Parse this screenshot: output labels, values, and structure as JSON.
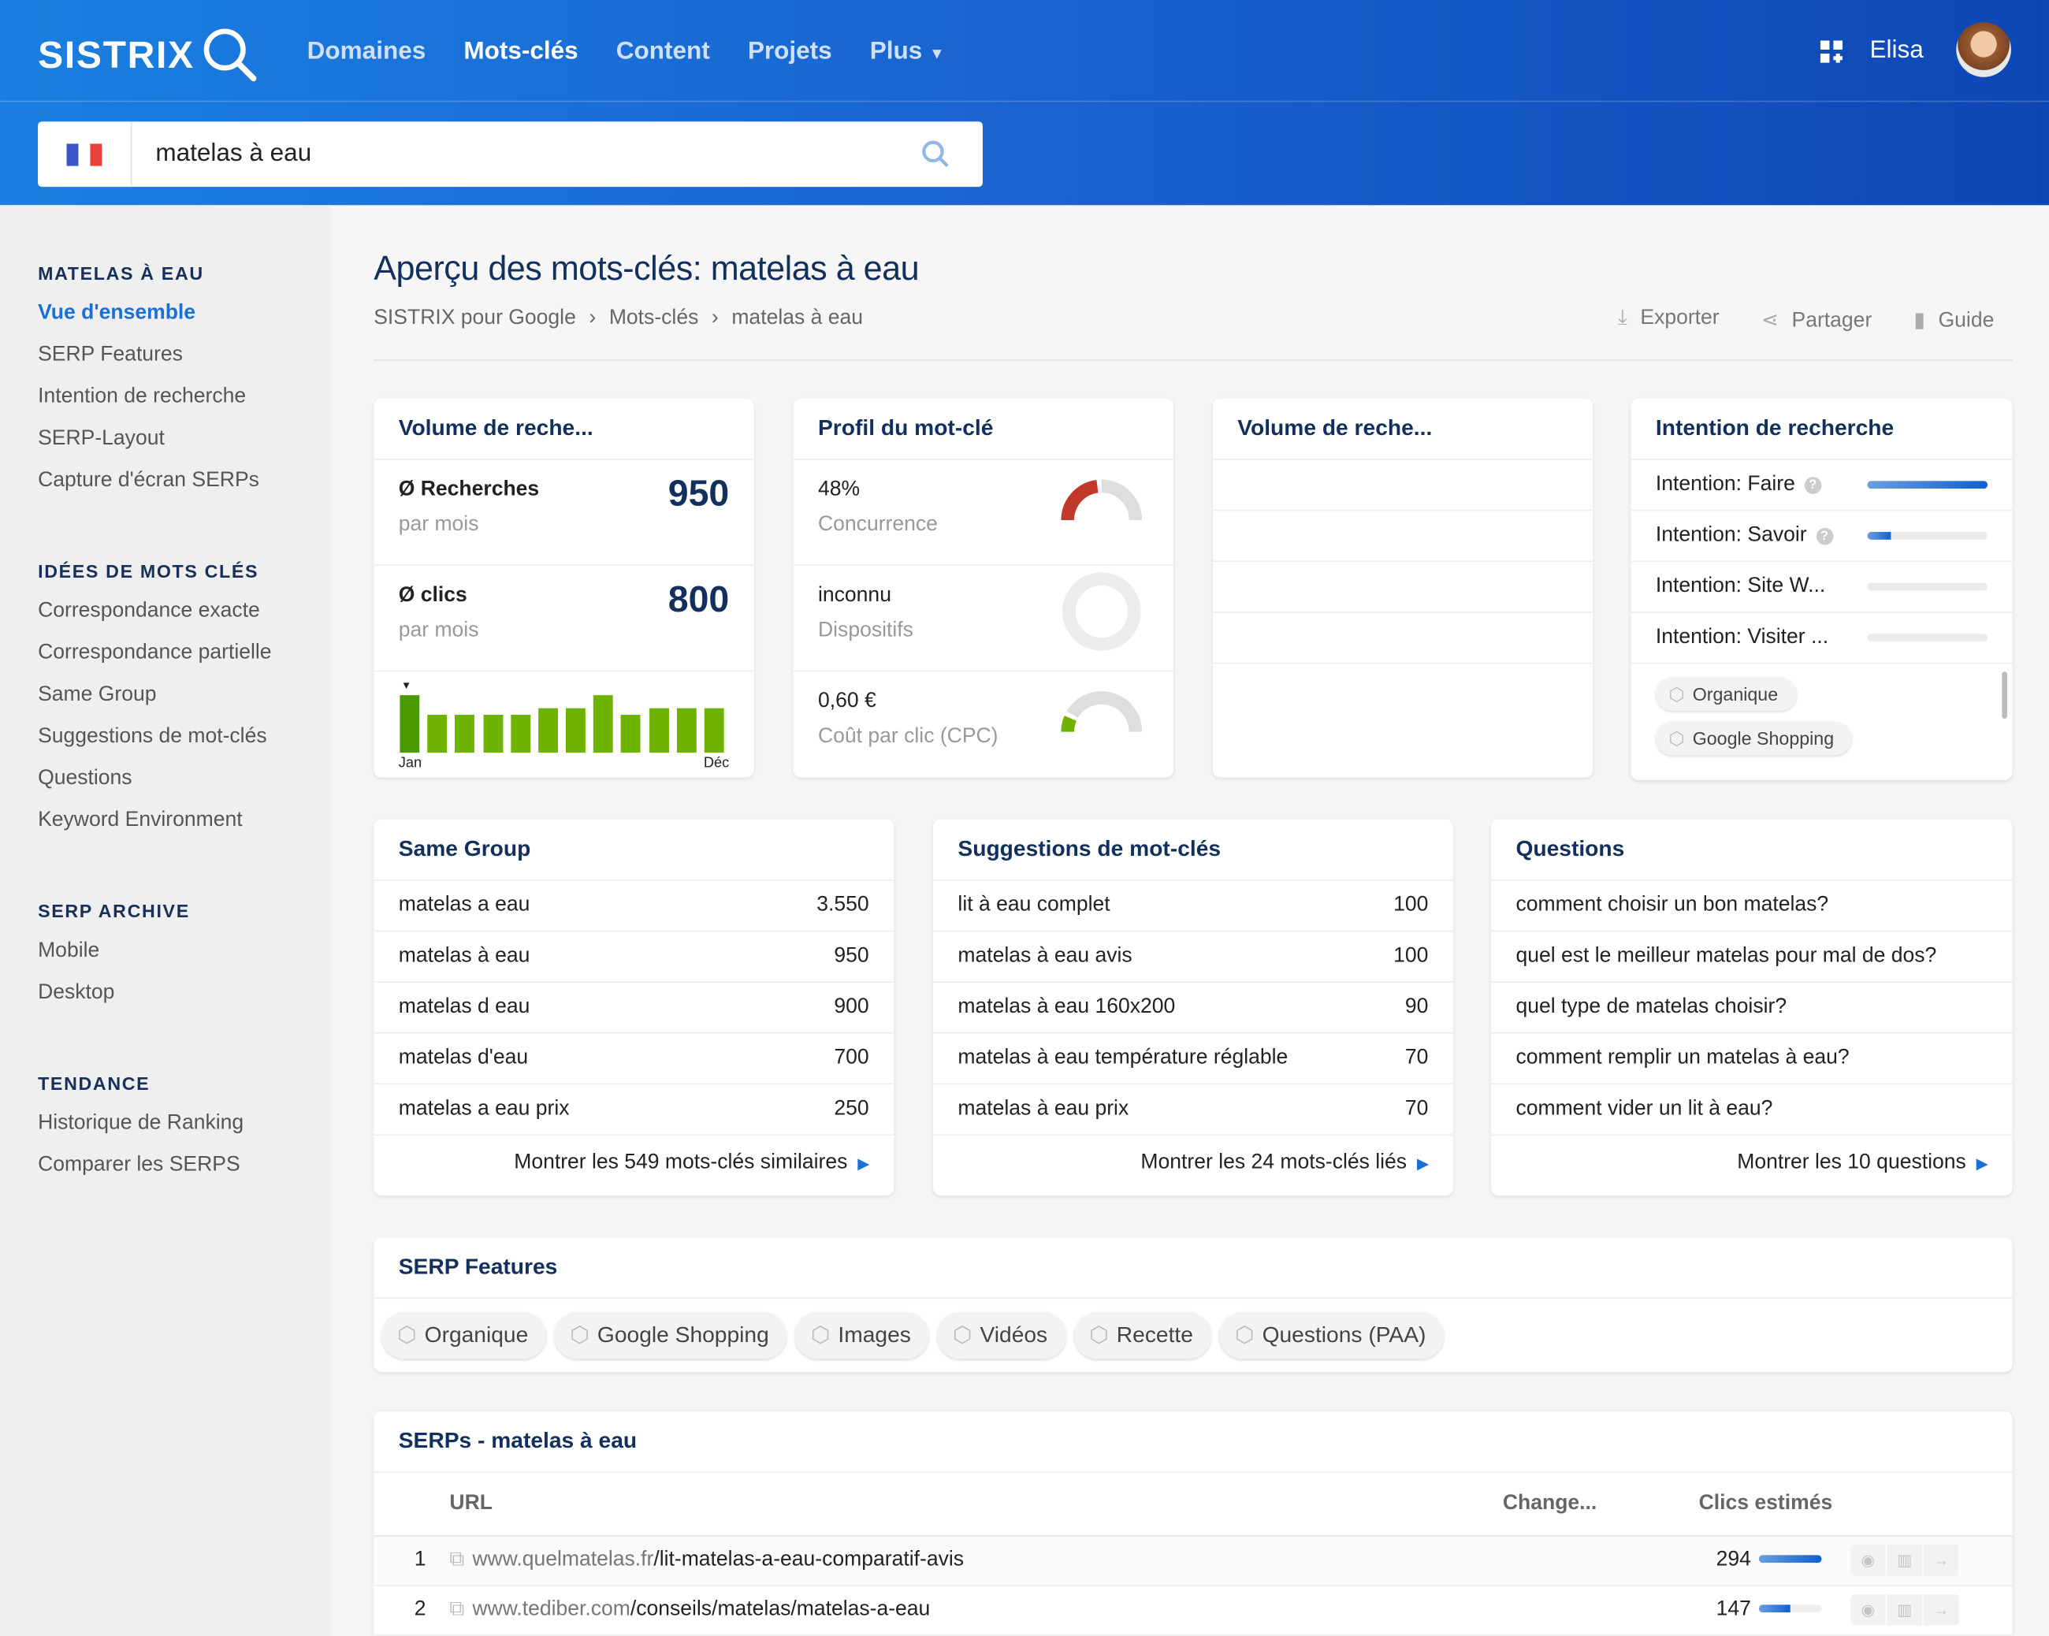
{
  "header": {
    "logo": "SISTRIX",
    "nav": [
      "Domaines",
      "Mots-clés",
      "Content",
      "Projets",
      "Plus"
    ],
    "active_nav": "Mots-clés",
    "user": "Elisa"
  },
  "search": {
    "value": "matelas à eau",
    "country": "France"
  },
  "sidebar": {
    "sections": [
      {
        "title": "MATELAS À EAU",
        "items": [
          "Vue d'ensemble",
          "SERP Features",
          "Intention de recherche",
          "SERP-Layout",
          "Capture d'écran SERPs"
        ]
      },
      {
        "title": "IDÉES DE MOTS CLÉS",
        "items": [
          "Correspondance exacte",
          "Correspondance partielle",
          "Same Group",
          "Suggestions de mot-clés",
          "Questions",
          "Keyword Environment"
        ]
      },
      {
        "title": "SERP ARCHIVE",
        "items": [
          "Mobile",
          "Desktop"
        ]
      },
      {
        "title": "TENDANCE",
        "items": [
          "Historique de Ranking",
          "Comparer les SERPS"
        ]
      }
    ],
    "active": "Vue d'ensemble"
  },
  "page": {
    "title": "Aperçu des mots-clés: matelas à eau",
    "breadcrumb": [
      "SISTRIX pour Google",
      "Mots-clés",
      "matelas à eau"
    ],
    "actions": [
      "Exporter",
      "Partager",
      "Guide"
    ]
  },
  "volume": {
    "title": "Volume de reche...",
    "searches_label": "Ø Recherches",
    "searches": "950",
    "clicks_label": "Ø clics",
    "clicks": "800",
    "per_month": "par mois",
    "chart_start": "Jan",
    "chart_end": "Déc",
    "monthly_relative": [
      1.0,
      0.67,
      0.67,
      0.67,
      0.67,
      0.77,
      0.77,
      1.0,
      0.67,
      0.77,
      0.77,
      0.77
    ],
    "bar_color": "#6db300"
  },
  "profile": {
    "title": "Profil du mot-clé",
    "competition": "48%",
    "competition_label": "Concurrence",
    "competition_pct": 48,
    "devices": "inconnu",
    "devices_label": "Dispositifs",
    "cpc": "0,60 €",
    "cpc_label": "Coût par clic (CPC)",
    "cpc_pct": 15
  },
  "volume2": {
    "title": "Volume de reche..."
  },
  "intent": {
    "title": "Intention de recherche",
    "items": [
      {
        "label": "Intention: Faire",
        "help": true,
        "pct": 100
      },
      {
        "label": "Intention: Savoir",
        "help": true,
        "pct": 20
      },
      {
        "label": "Intention: Site W...",
        "help": false,
        "pct": 0
      },
      {
        "label": "Intention: Visiter ...",
        "help": false,
        "pct": 0
      }
    ],
    "tags": [
      "Organique",
      "Google Shopping"
    ]
  },
  "same_group": {
    "title": "Same Group",
    "rows": [
      [
        "matelas a eau",
        "3.550"
      ],
      [
        "matelas à eau",
        "950"
      ],
      [
        "matelas d eau",
        "900"
      ],
      [
        "matelas d'eau",
        "700"
      ],
      [
        "matelas a eau prix",
        "250"
      ]
    ],
    "more": "Montrer les 549 mots-clés similaires"
  },
  "suggestions": {
    "title": "Suggestions de mot-clés",
    "rows": [
      [
        "lit à eau complet",
        "100"
      ],
      [
        "matelas à eau avis",
        "100"
      ],
      [
        "matelas à eau 160x200",
        "90"
      ],
      [
        "matelas à eau température réglable",
        "70"
      ],
      [
        "matelas à eau prix",
        "70"
      ]
    ],
    "more": "Montrer les 24 mots-clés liés"
  },
  "questions": {
    "title": "Questions",
    "rows": [
      "comment choisir un bon matelas?",
      "quel est le meilleur matelas pour mal de dos?",
      "quel type de matelas choisir?",
      "comment remplir un matelas à eau?",
      "comment vider un lit à eau?"
    ],
    "more": "Montrer les 10 questions"
  },
  "serp_features": {
    "title": "SERP Features",
    "tags": [
      "Organique",
      "Google Shopping",
      "Images",
      "Vidéos",
      "Recette",
      "Questions (PAA)"
    ]
  },
  "serps": {
    "title": "SERPs - matelas à eau",
    "columns": [
      "URL",
      "Change...",
      "Clics estimés"
    ],
    "rows": [
      {
        "pos": "1",
        "domain": "www.quelmatelas.fr",
        "path": "/lit-matelas-a-eau-comparatif-avis",
        "clicks": "294",
        "pct": 100
      },
      {
        "pos": "2",
        "domain": "www.tediber.com",
        "path": "/conseils/matelas/matelas-a-eau",
        "clicks": "147",
        "pct": 50
      }
    ]
  }
}
